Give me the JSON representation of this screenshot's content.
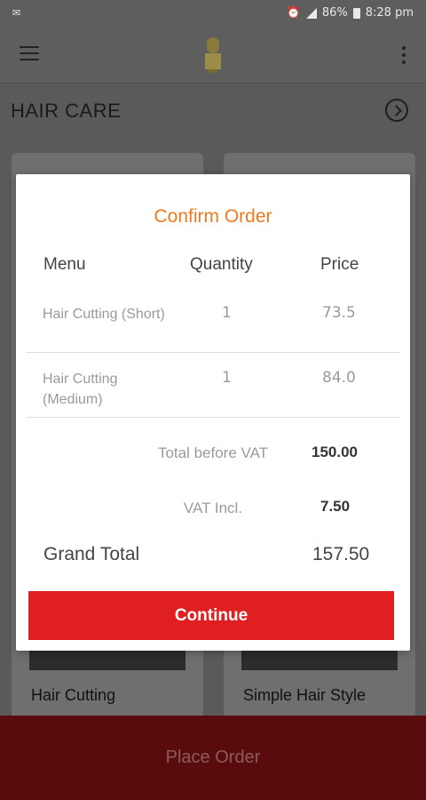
{
  "status_bar": {
    "battery": "86%",
    "time": "8:28 pm"
  },
  "header": {
    "section_title": "HAIR CARE"
  },
  "cards": [
    {
      "label": "Hair Cutting"
    },
    {
      "label": "Simple Hair Style"
    }
  ],
  "dialog": {
    "title": "Confirm Order",
    "columns": {
      "menu": "Menu",
      "quantity": "Quantity",
      "price": "Price"
    },
    "items": [
      {
        "name": "Hair Cutting (Short)",
        "quantity": "1",
        "price": "73.5"
      },
      {
        "name": "Hair Cutting (Medium)",
        "quantity": "1",
        "price": "84.0"
      }
    ],
    "total_before_vat_label": "Total before VAT",
    "total_before_vat": "150.00",
    "vat_label": "VAT Incl.",
    "vat": "7.50",
    "grand_total_label": "Grand Total",
    "grand_total": "157.50",
    "continue_label": "Continue"
  },
  "footer": {
    "place_order_label": "Place Order"
  },
  "colors": {
    "accent": "#f07a1e",
    "button": "#e02020",
    "footer": "#5a0c0c"
  }
}
